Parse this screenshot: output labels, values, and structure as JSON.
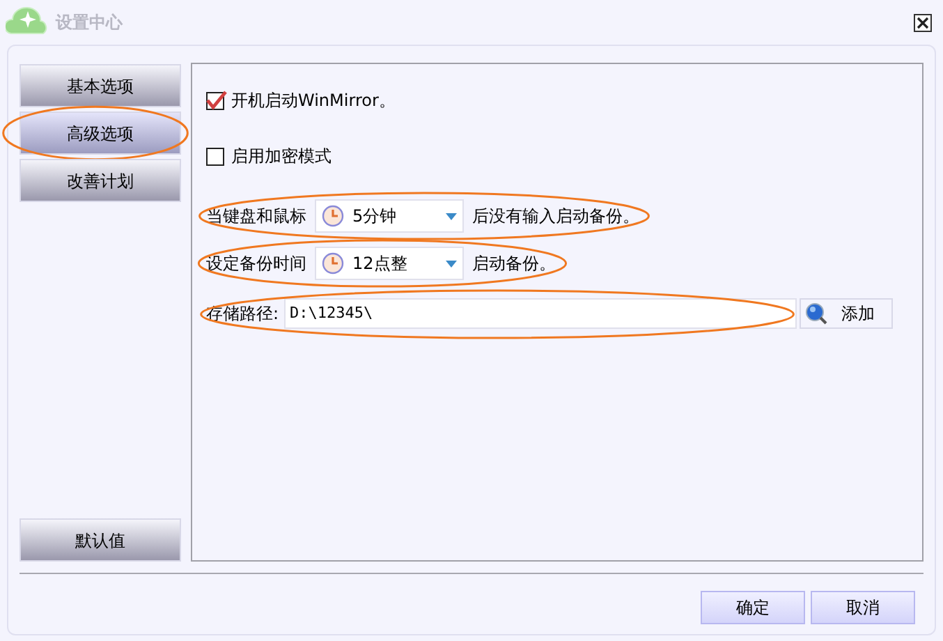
{
  "window": {
    "title": "设置中心"
  },
  "sidebar": {
    "items": [
      {
        "label": "基本选项",
        "selected": false,
        "highlighted": false
      },
      {
        "label": "高级选项",
        "selected": true,
        "highlighted": true
      },
      {
        "label": "改善计划",
        "selected": false,
        "highlighted": false
      }
    ],
    "default_button": "默认值"
  },
  "options": [
    {
      "kind": "checkbox",
      "label": "开机启动WinMirror。",
      "checked": true,
      "highlighted": false
    },
    {
      "kind": "checkbox",
      "label": "启用加密模式",
      "checked": false,
      "highlighted": false
    },
    {
      "kind": "dropdown",
      "label": "当键盘和鼠标",
      "value": "5分钟",
      "suffix": "后没有输入启动备份。",
      "highlighted": true
    },
    {
      "kind": "dropdown",
      "label": "设定备份时间",
      "value": "12点整",
      "suffix": "启动备份。",
      "highlighted": true
    },
    {
      "kind": "path",
      "label": "存储路径:",
      "value": "D:\\12345\\",
      "button": "添加",
      "highlighted": true
    }
  ],
  "buttons": [
    "确定",
    "取消"
  ]
}
